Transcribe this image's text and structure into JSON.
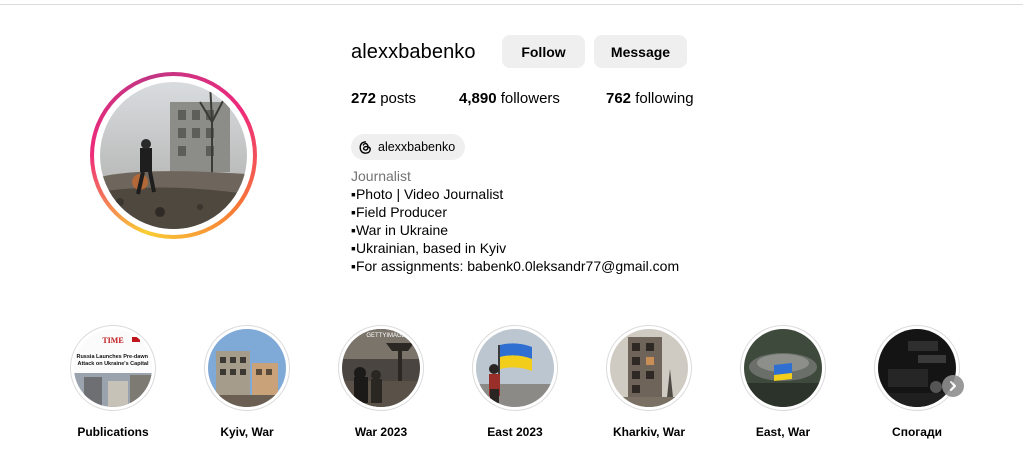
{
  "profile": {
    "username": "alexxbabenko",
    "follow_label": "Follow",
    "message_label": "Message",
    "stats": {
      "posts_count": "272",
      "posts_label": "posts",
      "followers_count": "4,890",
      "followers_label": "followers",
      "following_count": "762",
      "following_label": "following"
    },
    "threads_handle": "alexxbabenko",
    "bio": {
      "category": "Journalist",
      "lines": [
        "▪Photo | Video Journalist",
        "▪Field Producer",
        "▪War in Ukraine",
        "▪Ukrainian, based in Kyiv",
        "▪For assignments: babenk0.0leksandr77@gmail.com"
      ]
    }
  },
  "highlights": [
    {
      "label": "Publications"
    },
    {
      "label": "Kyiv, War"
    },
    {
      "label": "War 2023"
    },
    {
      "label": "East 2023"
    },
    {
      "label": "Kharkiv, War"
    },
    {
      "label": "East, War"
    },
    {
      "label": "Спогади"
    }
  ],
  "highlight_texts": {
    "time_logo": "TIME",
    "time_headline": "Russia Launches Pre-dawn Attack on Ukraine's Capital",
    "getty_text": "GETTYIMAGES"
  },
  "icons": {
    "threads": "threads-icon",
    "next": "chevron-right-icon"
  },
  "colors": {
    "button_bg": "#efefef",
    "category_text": "#737373",
    "ring_gradient": [
      "#f9ce34",
      "#ee2a7b",
      "#c13584",
      "#f77737"
    ]
  }
}
